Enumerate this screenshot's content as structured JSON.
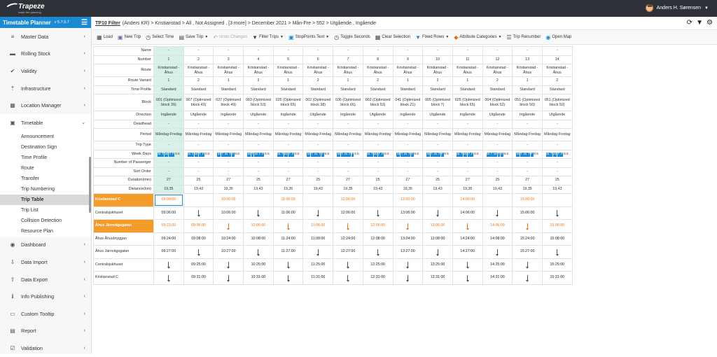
{
  "app": {
    "brand": "Trapeze",
    "tagline": "make the planning",
    "user": "Anders H. Sørensen",
    "title": "Timetable Planner",
    "version": "v 5.7.5.7"
  },
  "sidebar": {
    "items_top": [
      {
        "label": "Master Data",
        "icon": "database-icon"
      },
      {
        "label": "Rolling Stock",
        "icon": "truck-icon"
      },
      {
        "label": "Validity",
        "icon": "check-circle-icon"
      },
      {
        "label": "Infrastructure",
        "icon": "road-icon"
      },
      {
        "label": "Location Manager",
        "icon": "building-icon"
      },
      {
        "label": "Timetable",
        "icon": "calendar-icon"
      }
    ],
    "timetable_sub": [
      {
        "label": "Announcement",
        "active": false
      },
      {
        "label": "Destination Sign",
        "active": false
      },
      {
        "label": "Time Profile",
        "active": false
      },
      {
        "label": "Route",
        "active": false
      },
      {
        "label": "Transfer",
        "active": false
      },
      {
        "label": "Trip Numbering",
        "active": false
      },
      {
        "label": "Trip Table",
        "active": true
      },
      {
        "label": "Trip List",
        "active": false
      },
      {
        "label": "Collision Detection",
        "active": false
      },
      {
        "label": "Resource Plan",
        "active": false
      }
    ],
    "items_bottom": [
      {
        "label": "Dashboard",
        "icon": "dashboard-icon"
      },
      {
        "label": "Data Import",
        "icon": "database-import-icon"
      },
      {
        "label": "Data Export",
        "icon": "database-export-icon"
      },
      {
        "label": "Info Publishing",
        "icon": "info-icon"
      },
      {
        "label": "Custom Tooltip",
        "icon": "tooltip-icon"
      },
      {
        "label": "Report",
        "icon": "report-icon"
      },
      {
        "label": "Validation",
        "icon": "validation-icon"
      }
    ]
  },
  "filter": {
    "label": "TP10 Filter",
    "text": "(Anders KR) > Kristianstad > All , Not Assigned , [3 more] > December 2021 > Mån-Fre > 552 > Utgående , Ingående"
  },
  "toolbar": [
    {
      "label": "Load",
      "icon": "table-icon",
      "disabled": false,
      "dropdown": false
    },
    {
      "label": "New Trip",
      "icon": "bus-icon",
      "disabled": false,
      "dropdown": false
    },
    {
      "label": "Select Time",
      "icon": "clock-icon",
      "disabled": false,
      "dropdown": false
    },
    {
      "label": "Save Trip",
      "icon": "save-icon",
      "disabled": false,
      "dropdown": true
    },
    {
      "label": "Undo Changes",
      "icon": "undo-icon",
      "disabled": true,
      "dropdown": false
    },
    {
      "label": "Filter Trips",
      "icon": "filter-icon",
      "disabled": false,
      "dropdown": true
    },
    {
      "label": "StopPoints Text",
      "icon": "bus-stop-icon",
      "disabled": false,
      "dropdown": true
    },
    {
      "label": "Toggle Seconds",
      "icon": "clock-icon",
      "disabled": false,
      "dropdown": false
    },
    {
      "label": "Clear Selection",
      "icon": "grid-icon",
      "disabled": false,
      "dropdown": false
    },
    {
      "label": "Fixed Rows",
      "icon": "funnel-icon",
      "disabled": false,
      "dropdown": true
    },
    {
      "label": "Attribute Categories",
      "icon": "tag-icon",
      "disabled": false,
      "dropdown": true
    },
    {
      "label": "Trip Renumber",
      "icon": "list-icon",
      "disabled": false,
      "dropdown": false
    },
    {
      "label": "Open Map",
      "icon": "globe-icon",
      "disabled": false,
      "dropdown": false
    }
  ],
  "trips": {
    "row_labels": [
      "Name",
      "Number",
      "Route",
      "Route Variant",
      "Time Profile",
      "Block",
      "Direction",
      "Deadhead",
      "Period",
      "Trip Type",
      "Week Days",
      "Number of Passenger",
      "Sort Order",
      "Duration(min)",
      "Distance(km)"
    ],
    "columns": [
      {
        "name": "-",
        "number": "1",
        "route": "Kristianstad - Åhus",
        "variant": "1",
        "profile": "Standard",
        "block": "001 (Optimized block 39)",
        "direction": "Ingående",
        "deadhead": "-",
        "period": "Måndag-Fredag",
        "type": "-",
        "passengers": "-",
        "sort": "-",
        "duration": "27",
        "distance": "19,35"
      },
      {
        "name": "-",
        "number": "2",
        "route": "Kristianstad - Åhus",
        "variant": "2",
        "profile": "Standard",
        "block": "007 (Optimized block 43)",
        "direction": "Utgående",
        "deadhead": "-",
        "period": "Måndag-Fredag",
        "type": "-",
        "passengers": "-",
        "sort": "-",
        "duration": "25",
        "distance": "19,43"
      },
      {
        "name": "-",
        "number": "3",
        "route": "Kristianstad - Åhus",
        "variant": "1",
        "profile": "Standard",
        "block": "027 (Optimized block 49)",
        "direction": "Ingående",
        "deadhead": "-",
        "period": "Måndag-Fredag",
        "type": "-",
        "passengers": "-",
        "sort": "-",
        "duration": "27",
        "distance": "19,35"
      },
      {
        "name": "-",
        "number": "4",
        "route": "Kristianstad - Åhus",
        "variant": "2",
        "profile": "Standard",
        "block": "003 (Optimized block 53)",
        "direction": "Utgående",
        "deadhead": "-",
        "period": "Måndag-Fredag",
        "type": "-",
        "passengers": "-",
        "sort": "-",
        "duration": "25",
        "distance": "19,43"
      },
      {
        "name": "-",
        "number": "5",
        "route": "Kristianstad - Åhus",
        "variant": "1",
        "profile": "Standard",
        "block": "025 (Optimized block 65)",
        "direction": "Ingående",
        "deadhead": "-",
        "period": "Måndag-Fredag",
        "type": "-",
        "passengers": "-",
        "sort": "-",
        "duration": "27",
        "distance": "19,35"
      },
      {
        "name": "-",
        "number": "6",
        "route": "Kristianstad - Åhus",
        "variant": "2",
        "profile": "Standard",
        "block": "002 (Optimized block 38)",
        "direction": "Utgående",
        "deadhead": "-",
        "period": "Måndag-Fredag",
        "type": "-",
        "passengers": "-",
        "sort": "-",
        "duration": "25",
        "distance": "19,43"
      },
      {
        "name": "-",
        "number": "7",
        "route": "Kristianstad - Åhus",
        "variant": "1",
        "profile": "Standard",
        "block": "036 (Optimized block 66)",
        "direction": "Ingående",
        "deadhead": "-",
        "period": "Måndag-Fredag",
        "type": "-",
        "passengers": "-",
        "sort": "-",
        "duration": "27",
        "distance": "19,35"
      },
      {
        "name": "-",
        "number": "8",
        "route": "Kristianstad - Åhus",
        "variant": "2",
        "profile": "Standard",
        "block": "003 (Optimized block 53)",
        "direction": "Utgående",
        "deadhead": "-",
        "period": "Måndag-Fredag",
        "type": "-",
        "passengers": "-",
        "sort": "-",
        "duration": "25",
        "distance": "19,43"
      },
      {
        "name": "-",
        "number": "9",
        "route": "Kristianstad - Åhus",
        "variant": "1",
        "profile": "Standard",
        "block": "041 (Optimized block 21)",
        "direction": "Ingående",
        "deadhead": "-",
        "period": "Måndag-Fredag",
        "type": "-",
        "passengers": "-",
        "sort": "-",
        "duration": "27",
        "distance": "19,35"
      },
      {
        "name": "-",
        "number": "10",
        "route": "Kristianstad - Åhus",
        "variant": "2",
        "profile": "Standard",
        "block": "005 (Optimized block 7)",
        "direction": "Utgående",
        "deadhead": "-",
        "period": "Måndag-Fredag",
        "type": "-",
        "passengers": "-",
        "sort": "-",
        "duration": "25",
        "distance": "19,43"
      },
      {
        "name": "-",
        "number": "11",
        "route": "Kristianstad - Åhus",
        "variant": "1",
        "profile": "Standard",
        "block": "025 (Optimized block 65)",
        "direction": "Ingående",
        "deadhead": "-",
        "period": "Måndag-Fredag",
        "type": "-",
        "passengers": "-",
        "sort": "-",
        "duration": "27",
        "distance": "19,35"
      },
      {
        "name": "-",
        "number": "12",
        "route": "Kristianstad - Åhus",
        "variant": "2",
        "profile": "Standard",
        "block": "004 (Optimized block 52)",
        "direction": "Utgående",
        "deadhead": "-",
        "period": "Måndag-Fredag",
        "type": "-",
        "passengers": "-",
        "sort": "-",
        "duration": "25",
        "distance": "19,43"
      },
      {
        "name": "-",
        "number": "13",
        "route": "Kristianstad - Åhus",
        "variant": "1",
        "profile": "Standard",
        "block": "051 (Optimized block 50)",
        "direction": "Ingående",
        "deadhead": "-",
        "period": "Måndag-Fredag",
        "type": "-",
        "passengers": "-",
        "sort": "-",
        "duration": "27",
        "distance": "19,35"
      },
      {
        "name": "-",
        "number": "14",
        "route": "Kristianstad - Åhus",
        "variant": "2",
        "profile": "Standard",
        "block": "051 (Optimized block 50)",
        "direction": "Utgående",
        "deadhead": "-",
        "period": "Måndag-Fredag",
        "type": "-",
        "passengers": "-",
        "sort": "-",
        "duration": "25",
        "distance": "19,43"
      }
    ],
    "weekdays_on": "MTWTF",
    "weekdays_off": "SS"
  },
  "stops": [
    {
      "name": "Kristianstad C",
      "orange": true,
      "times": [
        "09:00:00",
        "",
        "10:00:00",
        "",
        "11:00:00",
        "",
        "12:00:00",
        "",
        "13:00:00",
        "",
        "14:00:00",
        "",
        "15:00:00",
        ""
      ],
      "color": "or"
    },
    {
      "name": "Centralsjukhuset",
      "orange": false,
      "times": [
        "09:06:00",
        "",
        "10:06:00",
        "",
        "11:06:00",
        "",
        "12:06:00",
        "",
        "13:06:00",
        "",
        "14:06:00",
        "",
        "15:06:00",
        ""
      ],
      "color": "bk"
    },
    {
      "name": "Åhus Järnvägsgatan",
      "orange": true,
      "times": [
        "09:23:00",
        "09:06:00",
        "",
        "10:06:00",
        "",
        "11:06:00",
        "",
        "12:06:00",
        "",
        "13:06:00",
        "",
        "14:06:00",
        "",
        "15:06:00"
      ],
      "color": "or"
    },
    {
      "name": "Åhus Åhusbryggan",
      "orange": false,
      "times": [
        "09:24:00",
        "09:08:00",
        "10:24:00",
        "10:08:00",
        "11:24:00",
        "11:08:00",
        "12:24:00",
        "12:08:00",
        "13:24:00",
        "13:08:00",
        "14:24:00",
        "14:08:00",
        "15:24:00",
        "15:08:00"
      ],
      "color": "bk"
    },
    {
      "name": "Åhus Järnvägsgatan",
      "orange": false,
      "times": [
        "09:27:00",
        "",
        "10:27:00",
        "",
        "11:27:00",
        "",
        "12:27:00",
        "",
        "13:27:00",
        "",
        "14:27:00",
        "",
        "15:27:00",
        ""
      ],
      "color": "bk"
    },
    {
      "name": "Centralsjukhuset",
      "orange": false,
      "times": [
        "",
        "09:25:00",
        "",
        "10:25:00",
        "",
        "11:25:00",
        "",
        "12:25:00",
        "",
        "13:25:00",
        "",
        "14:25:00",
        "",
        "15:25:00"
      ],
      "color": "bk"
    },
    {
      "name": "Kristianstad C",
      "orange": false,
      "times": [
        "",
        "09:31:00",
        "",
        "10:31:00",
        "",
        "11:31:00",
        "",
        "12:31:00",
        "",
        "13:31:00",
        "",
        "14:31:00",
        "",
        "15:31:00"
      ],
      "color": "bk"
    }
  ]
}
